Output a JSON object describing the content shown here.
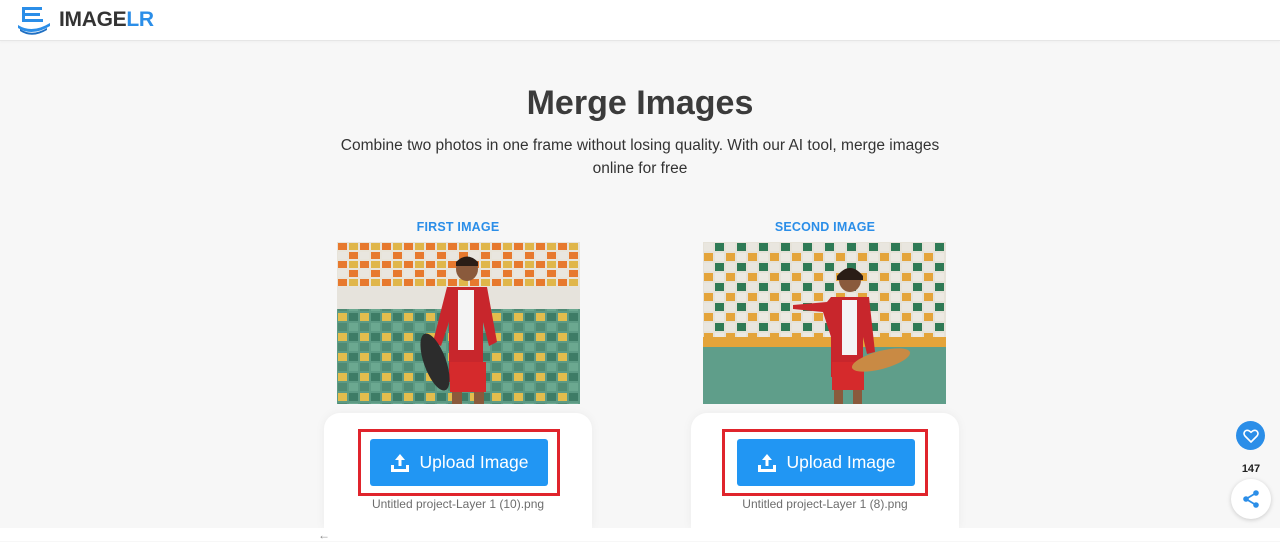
{
  "header": {
    "logo_text_main": "IMAGE",
    "logo_text_accent": "LR",
    "logo_icon": "imagelr-logo-icon"
  },
  "hero": {
    "title": "Merge Images",
    "subtitle": "Combine two photos in one frame without losing quality. With our AI tool, merge images online for free"
  },
  "images": [
    {
      "label": "FIRST IMAGE",
      "upload_label": "Upload Image",
      "file_name": "Untitled project-Layer 1 (10).png"
    },
    {
      "label": "SECOND IMAGE",
      "upload_label": "Upload Image",
      "file_name": "Untitled project-Layer 1 (8).png"
    }
  ],
  "share": {
    "count": "147",
    "heart_icon": "heart-icon",
    "share_icon": "share-icon"
  },
  "footer": {
    "back_arrow": "←"
  },
  "colors": {
    "accent": "#2b8ee8",
    "button": "#2196f3",
    "highlight": "#e0242c"
  }
}
